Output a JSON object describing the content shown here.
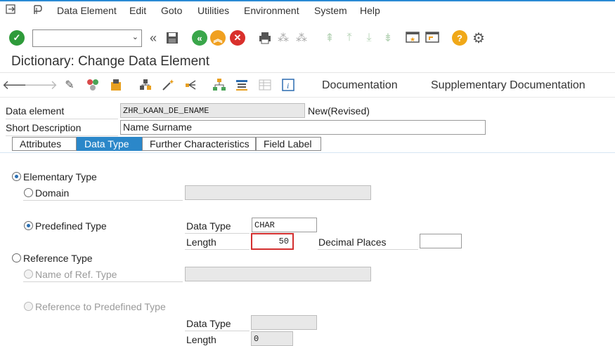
{
  "menu": {
    "items": [
      "Data Element",
      "Edit",
      "Goto",
      "Utilities",
      "Environment",
      "System",
      "Help"
    ]
  },
  "toolbar": {
    "command_field_value": ""
  },
  "title": "Dictionary: Change Data Element",
  "app_toolbar": {
    "documentation": "Documentation",
    "supplementary_documentation": "Supplementary Documentation"
  },
  "header": {
    "data_element_label": "Data element",
    "data_element_value": "ZHR_KAAN_DE_ENAME",
    "status": "New(Revised)",
    "short_description_label": "Short Description",
    "short_description_value": "Name Surname"
  },
  "tabs": [
    {
      "label": "Attributes",
      "active": false
    },
    {
      "label": "Data Type",
      "active": true
    },
    {
      "label": "Further Characteristics",
      "active": false
    },
    {
      "label": "Field Label",
      "active": false
    }
  ],
  "data_type_tab": {
    "elementary_type": "Elementary Type",
    "domain": "Domain",
    "domain_value": "",
    "predefined_type": "Predefined Type",
    "data_type_label": "Data Type",
    "data_type_value": "CHAR",
    "length_label": "Length",
    "length_value": "50",
    "decimal_places_label": "Decimal Places",
    "decimal_places_value": "",
    "reference_type": "Reference Type",
    "name_of_ref_type": "Name of Ref. Type",
    "name_of_ref_type_value": "",
    "reference_to_predefined_type": "Reference to Predefined Type",
    "ref_data_type_label": "Data Type",
    "ref_data_type_value": "",
    "ref_length_label": "Length",
    "ref_length_value": "0"
  },
  "colors": {
    "accent": "#2b87c9",
    "enter_green": "#2e9b3a",
    "nav_green": "#3aa64a",
    "exit_orange": "#f0a020",
    "cancel_red": "#d9302c",
    "help_yellow": "#f0a818"
  }
}
